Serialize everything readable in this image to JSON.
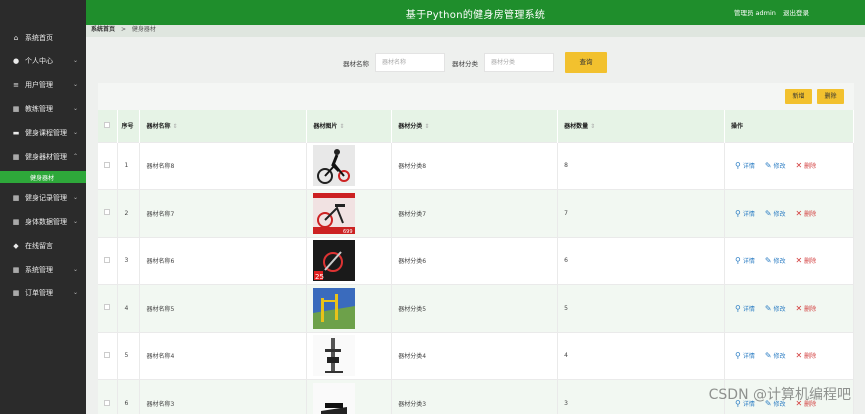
{
  "header": {
    "title": "基于Python的健身房管理系统",
    "user": "管理员 admin",
    "logout": "退出登录"
  },
  "breadcrumb": {
    "home": "系统首页",
    "sep": ">",
    "current": "健身器材"
  },
  "sidebar": {
    "items": [
      {
        "label": "系统首页",
        "icon": "home-icon",
        "glyph": "⌂",
        "chev": ""
      },
      {
        "label": "个人中心",
        "icon": "user-icon",
        "glyph": "●",
        "chev": "⌄"
      },
      {
        "label": "用户管理",
        "icon": "list-icon",
        "glyph": "≡",
        "chev": "⌄"
      },
      {
        "label": "教练管理",
        "icon": "grid-icon",
        "glyph": "▦",
        "chev": "⌄"
      },
      {
        "label": "健身课程管理",
        "icon": "monitor-icon",
        "glyph": "▬",
        "chev": "⌄"
      },
      {
        "label": "健身器材管理",
        "icon": "grid-icon",
        "glyph": "▦",
        "chev": "⌃"
      },
      {
        "label": "健身记录管理",
        "icon": "grid-icon",
        "glyph": "▦",
        "chev": "⌄"
      },
      {
        "label": "身体数据管理",
        "icon": "grid-icon",
        "glyph": "▦",
        "chev": "⌄"
      },
      {
        "label": "在线留言",
        "icon": "pin-icon",
        "glyph": "◆",
        "chev": ""
      },
      {
        "label": "系统管理",
        "icon": "grid-icon",
        "glyph": "▦",
        "chev": "⌄"
      },
      {
        "label": "订单管理",
        "icon": "grid-icon",
        "glyph": "▦",
        "chev": "⌄"
      }
    ],
    "sub_active": "健身器材"
  },
  "search": {
    "name_label": "器材名称",
    "name_placeholder": "器材名称",
    "cat_label": "器材分类",
    "cat_placeholder": "器材分类",
    "button": "查询"
  },
  "actions": {
    "add": "新增",
    "delete": "删除"
  },
  "table": {
    "headers": {
      "index": "序号",
      "name": "器材名称",
      "image": "器材图片",
      "category": "器材分类",
      "qty": "器材数量",
      "ops": "操作"
    },
    "op_labels": {
      "detail": "详情",
      "edit": "修改",
      "delete": "删除"
    },
    "rows": [
      {
        "index": "1",
        "name": "器材名称8",
        "category": "器材分类8",
        "qty": "8",
        "img": "spin-bike-rider"
      },
      {
        "index": "2",
        "name": "器材名称7",
        "category": "器材分类7",
        "qty": "7",
        "img": "spin-bike-red"
      },
      {
        "index": "3",
        "name": "器材名称6",
        "category": "器材分类6",
        "qty": "6",
        "img": "spin-bike-black"
      },
      {
        "index": "4",
        "name": "器材名称5",
        "category": "器材分类5",
        "qty": "5",
        "img": "outdoor-equipment"
      },
      {
        "index": "5",
        "name": "器材名称4",
        "category": "器材分类4",
        "qty": "4",
        "img": "weight-machine"
      },
      {
        "index": "6",
        "name": "器材名称3",
        "category": "器材分类3",
        "qty": "3",
        "img": "stepper"
      }
    ]
  },
  "watermark": "CSDN @计算机编程吧"
}
